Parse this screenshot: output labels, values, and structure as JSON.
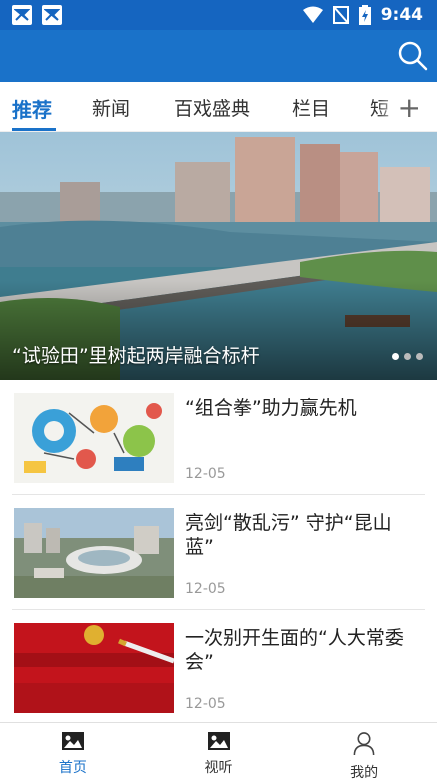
{
  "status_bar": {
    "time": "9:44",
    "icons": [
      "app-notification-icon",
      "app-notification-icon",
      "wifi-icon",
      "no-signal-icon",
      "battery-charging-icon"
    ]
  },
  "header": {
    "search_icon": "search-icon"
  },
  "tabs": [
    {
      "label": "推荐",
      "active": true
    },
    {
      "label": "新闻"
    },
    {
      "label": "百戏盛典"
    },
    {
      "label": "栏目"
    },
    {
      "label": "短"
    }
  ],
  "add_tab_label": "+",
  "banner": {
    "caption": "“试验田”里树起两岸融合标杆",
    "slide_count": 3,
    "active_slide": 1
  },
  "news": [
    {
      "title": "“组合拳”助力赢先机",
      "date": "12-05"
    },
    {
      "title": "亮剑“散乱污” 守护“昆山蓝”",
      "date": "12-05"
    },
    {
      "title": "一次别开生面的“人大常委会”",
      "date": "12-05"
    }
  ],
  "bottom_nav": [
    {
      "label": "首页",
      "icon": "image-icon",
      "active": true
    },
    {
      "label": "视听",
      "icon": "image-icon"
    },
    {
      "label": "我的",
      "icon": "person-icon"
    }
  ],
  "colors": {
    "primary": "#1a72c9",
    "status_bar": "#1565c0"
  }
}
